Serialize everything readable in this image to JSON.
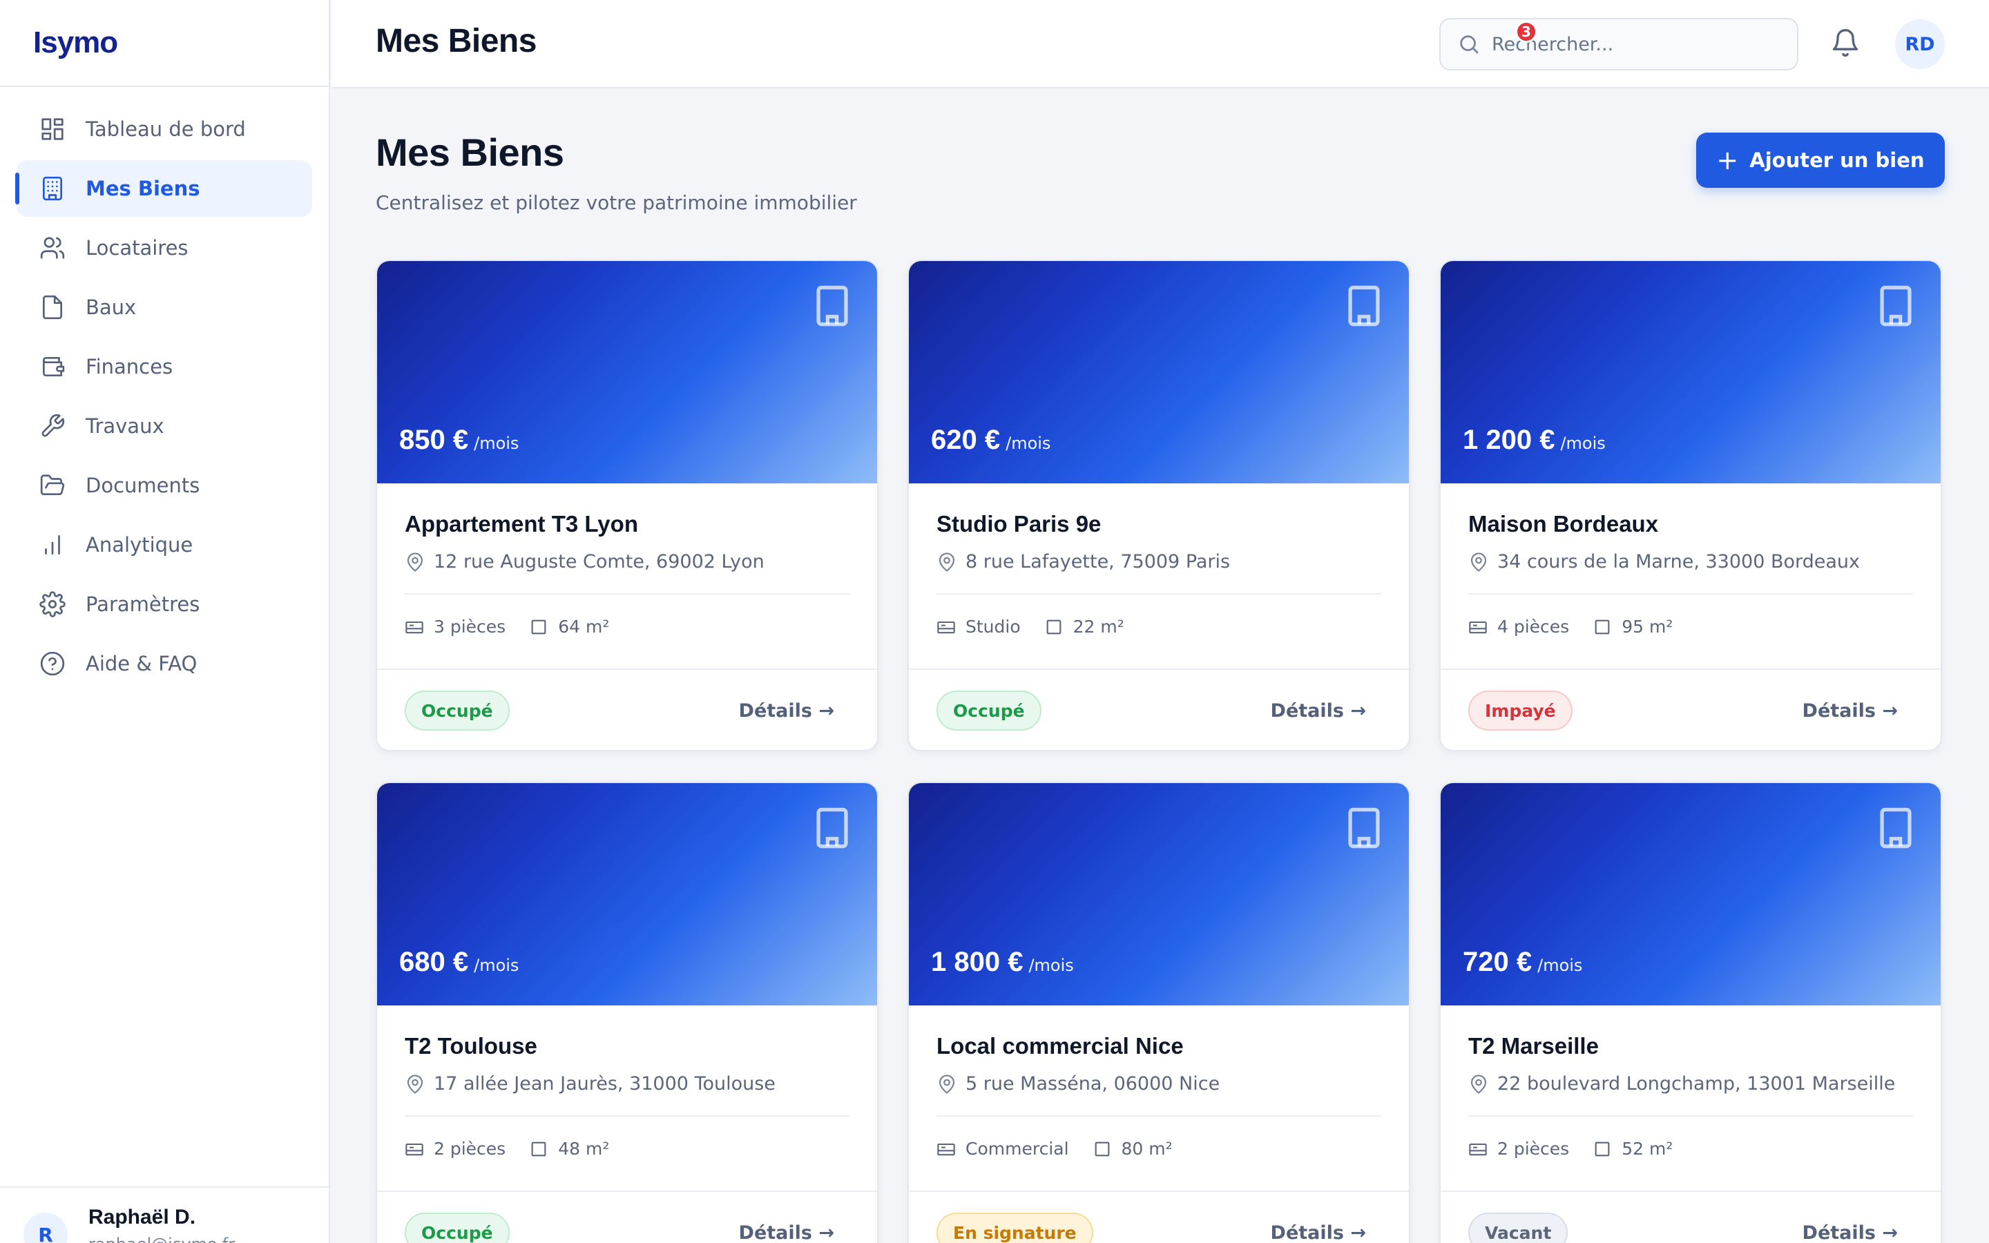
{
  "app": {
    "name": "Isymo"
  },
  "sidebar": {
    "items": [
      {
        "label": "Tableau de bord",
        "icon": "dashboard-icon"
      },
      {
        "label": "Mes Biens",
        "icon": "building-icon",
        "active": true
      },
      {
        "label": "Locataires",
        "icon": "users-icon"
      },
      {
        "label": "Baux",
        "icon": "file-icon"
      },
      {
        "label": "Finances",
        "icon": "wallet-icon"
      },
      {
        "label": "Travaux",
        "icon": "wrench-icon"
      },
      {
        "label": "Documents",
        "icon": "folder-icon"
      },
      {
        "label": "Analytique",
        "icon": "bar-chart-icon"
      },
      {
        "label": "Paramètres",
        "icon": "gear-icon"
      },
      {
        "label": "Aide & FAQ",
        "icon": "help-icon"
      }
    ],
    "user": {
      "initial": "R",
      "name": "Raphaël D.",
      "email": "raphael@isymo.fr"
    }
  },
  "header": {
    "title": "Mes Biens",
    "search_placeholder": "Rechercher...",
    "notification_count": "3",
    "avatar_initials": "RD"
  },
  "main": {
    "title": "Mes Biens",
    "subtitle": "Centralisez et pilotez votre patrimoine immobilier",
    "add_button": "Ajouter un bien",
    "details_label": "Détails →",
    "per_month": "/mois",
    "properties": [
      {
        "price": "850 €",
        "name": "Appartement T3 Lyon",
        "address": "12 rue Auguste Comte, 69002 Lyon",
        "rooms": "3 pièces",
        "area": "64 m²",
        "status": "Occupé",
        "status_type": "ok"
      },
      {
        "price": "620 €",
        "name": "Studio Paris 9e",
        "address": "8 rue Lafayette, 75009 Paris",
        "rooms": "Studio",
        "area": "22 m²",
        "status": "Occupé",
        "status_type": "ok"
      },
      {
        "price": "1 200 €",
        "name": "Maison Bordeaux",
        "address": "34 cours de la Marne, 33000 Bordeaux",
        "rooms": "4 pièces",
        "area": "95 m²",
        "status": "Impayé",
        "status_type": "bad"
      },
      {
        "price": "680 €",
        "name": "T2 Toulouse",
        "address": "17 allée Jean Jaurès, 31000 Toulouse",
        "rooms": "2 pièces",
        "area": "48 m²",
        "status": "Occupé",
        "status_type": "ok"
      },
      {
        "price": "1 800 €",
        "name": "Local commercial Nice",
        "address": "5 rue Masséna, 06000 Nice",
        "rooms": "Commercial",
        "area": "80 m²",
        "status": "En signature",
        "status_type": "sign"
      },
      {
        "price": "720 €",
        "name": "T2 Marseille",
        "address": "22 boulevard Longchamp, 13001 Marseille",
        "rooms": "2 pièces",
        "area": "52 m²",
        "status": "Vacant",
        "status_type": "vac"
      }
    ]
  },
  "colors": {
    "accent": "#1f5ae0",
    "brand": "#13228f",
    "ok": "#1a9b47",
    "bad": "#d8323b",
    "sign": "#c67a06"
  }
}
